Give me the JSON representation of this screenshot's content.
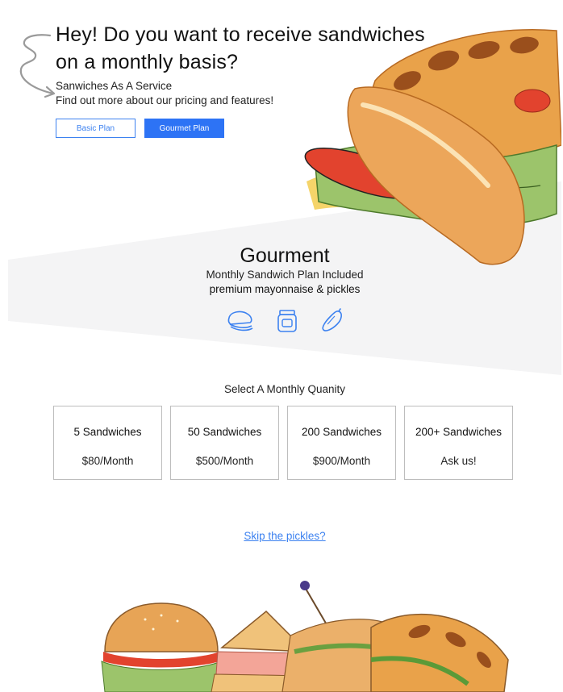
{
  "hero": {
    "title": "Hey! Do you want to receive sandwiches on a monthly basis?",
    "subtitle": "Sanwiches As A Service",
    "tagline": "Find out more about our pricing and features!",
    "buttons": {
      "basic_label": "Basic Plan",
      "gourmet_label": "Gourmet Plan"
    }
  },
  "plan": {
    "title": "Gourment",
    "subtitle": "Monthly Sandwich Plan Included",
    "extras": "premium mayonnaise & pickles",
    "icons": [
      "sandwich-icon",
      "jar-icon",
      "pickle-icon"
    ]
  },
  "quantity": {
    "title": "Select A Monthly Quanity",
    "options": [
      {
        "name": "5 Sandwiches",
        "price": "$80/Month"
      },
      {
        "name": "50 Sandwiches",
        "price": "$500/Month"
      },
      {
        "name": "200 Sandwiches",
        "price": "$900/Month"
      },
      {
        "name": "200+ Sandwiches",
        "price": "Ask us!"
      }
    ]
  },
  "skip": {
    "label": "Skip the pickles?"
  },
  "colors": {
    "accent": "#2d73f5",
    "outline_accent": "#3d82f0",
    "band": "#f4f4f5"
  }
}
